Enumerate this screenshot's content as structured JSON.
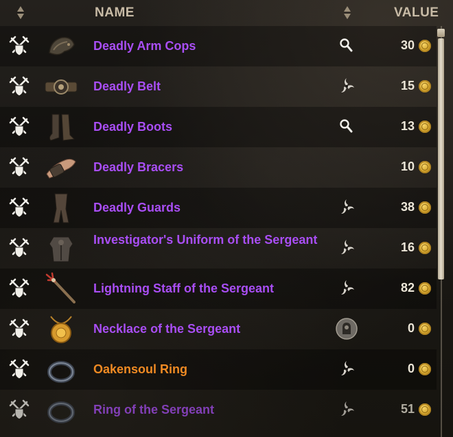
{
  "header": {
    "name_label": "NAME",
    "value_label": "VALUE"
  },
  "items": [
    {
      "name": "Deadly Arm Cops",
      "value": "30",
      "quality": "epic",
      "trait_icon": "magnifier-icon",
      "item_icon": "arm-cops-icon"
    },
    {
      "name": "Deadly Belt",
      "value": "15",
      "quality": "epic",
      "trait_icon": "swirl-icon",
      "item_icon": "belt-icon"
    },
    {
      "name": "Deadly Boots",
      "value": "13",
      "quality": "epic",
      "trait_icon": "magnifier-icon",
      "item_icon": "boots-icon"
    },
    {
      "name": "Deadly Bracers",
      "value": "10",
      "quality": "epic",
      "trait_icon": "",
      "item_icon": "bracers-icon"
    },
    {
      "name": "Deadly Guards",
      "value": "38",
      "quality": "epic",
      "trait_icon": "swirl-icon",
      "item_icon": "guards-icon"
    },
    {
      "name": "Investigator's Uniform of the Sergeant",
      "value": "16",
      "quality": "epic",
      "trait_icon": "swirl-icon",
      "item_icon": "uniform-icon"
    },
    {
      "name": "Lightning Staff of the Sergeant",
      "value": "82",
      "quality": "epic",
      "trait_icon": "swirl-icon",
      "item_icon": "staff-icon"
    },
    {
      "name": "Necklace of the Sergeant",
      "value": "0",
      "quality": "epic",
      "trait_icon": "armory-icon",
      "item_icon": "necklace-icon"
    },
    {
      "name": "Oakensoul Ring",
      "value": "0",
      "quality": "legendary",
      "trait_icon": "swirl-icon",
      "item_icon": "ring-icon"
    },
    {
      "name": "Ring of the Sergeant",
      "value": "51",
      "quality": "epic",
      "trait_icon": "swirl-icon",
      "item_icon": "ring-icon"
    }
  ],
  "colors": {
    "epic": "#a94ef5",
    "legendary": "#ef8a23",
    "header": "#c8bba6",
    "value": "#ece6d8"
  },
  "status_icon": "crossed-swords-shield-icon",
  "currency_icon": "gold-coin-icon"
}
